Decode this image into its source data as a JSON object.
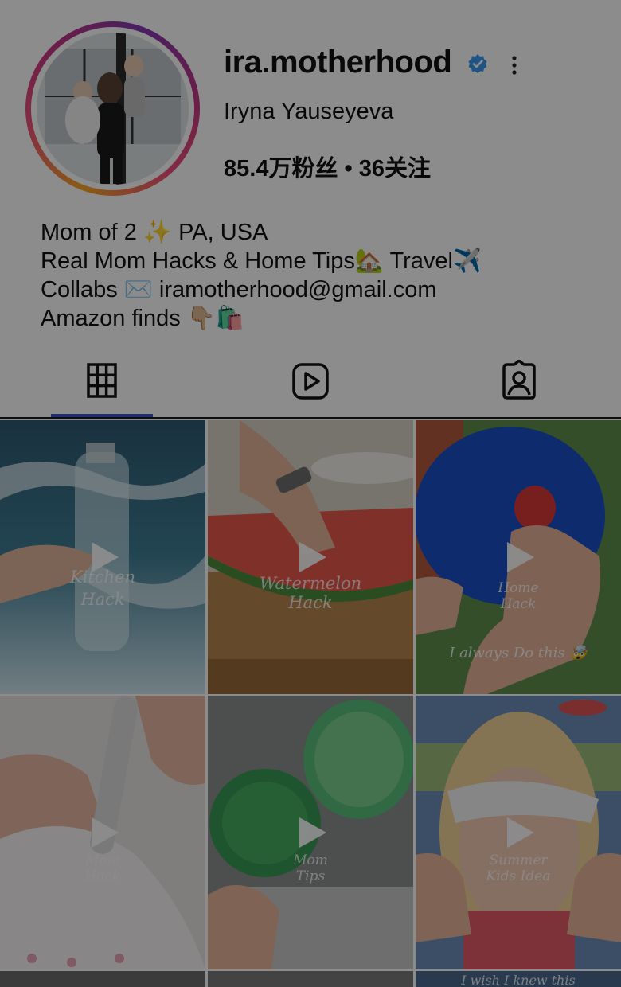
{
  "profile": {
    "username": "ira.motherhood",
    "full_name": "Iryna Yauseyeva",
    "stats": "85.4万粉丝 • 36关注",
    "verified_icon": "verified-badge-icon",
    "verified_color": "#3897f0",
    "more_icon": "vertical-ellipsis-icon"
  },
  "bio": [
    "Mom of 2 ✨  PA, USA",
    "Real Mom Hacks & Home Tips🏡 Travel✈️",
    "Collabs ✉️  iramotherhood@gmail.com",
    "Amazon finds 👇🏼🛍️"
  ],
  "tabs": [
    {
      "icon": "grid-icon",
      "active": true
    },
    {
      "icon": "reels-icon",
      "active": false
    },
    {
      "icon": "tagged-icon",
      "active": false
    }
  ],
  "accent_color": "#3b55c9",
  "posts": [
    {
      "caption1": "Kitchen",
      "caption2": "Hack",
      "extra": ""
    },
    {
      "caption1": "Watermelon",
      "caption2": "Hack",
      "extra": ""
    },
    {
      "caption1": "Home",
      "caption2": "Hack",
      "extra": "I always Do this 🤯"
    },
    {
      "caption1": "Mom",
      "caption2": "Hack",
      "extra": ""
    },
    {
      "caption1": "Mom",
      "caption2": "Tips",
      "extra": ""
    },
    {
      "caption1": "Summer",
      "caption2": "Kids Idea",
      "extra": ""
    }
  ],
  "next_row_partial_caption": "I wish I knew this"
}
